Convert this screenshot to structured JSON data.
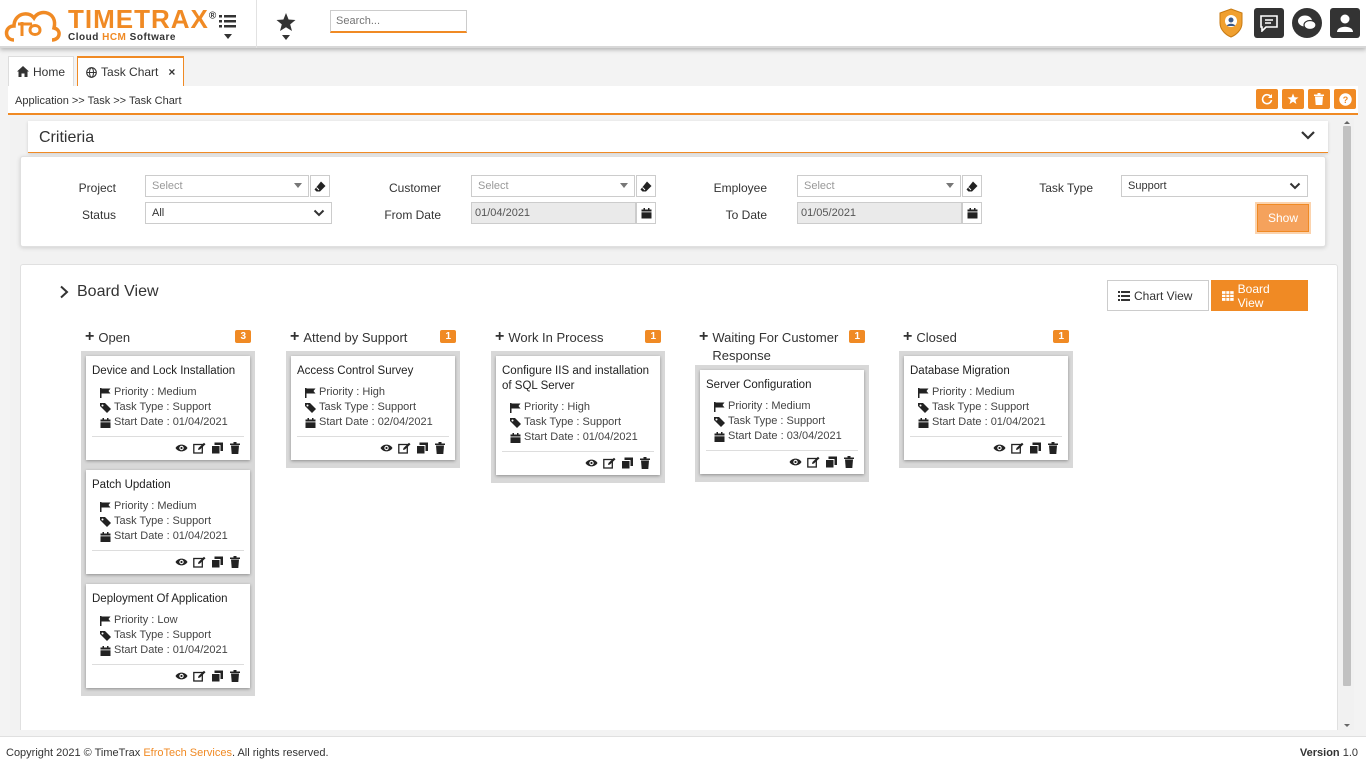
{
  "app": {
    "logo_title": "TIMETRAX",
    "logo_registered": "®",
    "logo_sub_prefix": "Cloud ",
    "logo_sub_accent": "HCM",
    "logo_sub_suffix": " Software",
    "search_placeholder": "Search...",
    "accent_color": "#f08a24"
  },
  "tabs": [
    {
      "label": "Home",
      "icon": "home-icon",
      "active": false
    },
    {
      "label": "Task Chart",
      "icon": "globe-icon",
      "active": true,
      "closable": true
    }
  ],
  "breadcrumb": "Application >> Task >> Task Chart",
  "criteria": {
    "title": "Critieria",
    "fields": {
      "project": {
        "label": "Project",
        "value": "Select"
      },
      "customer": {
        "label": "Customer",
        "value": "Select"
      },
      "employee": {
        "label": "Employee",
        "value": "Select"
      },
      "task_type": {
        "label": "Task Type",
        "value": "Support"
      },
      "status": {
        "label": "Status",
        "value": "All"
      },
      "from_date": {
        "label": "From Date",
        "value": "01/04/2021"
      },
      "to_date": {
        "label": "To Date",
        "value": "01/05/2021"
      }
    },
    "show_label": "Show"
  },
  "board": {
    "title": "Board View",
    "chart_view_label": "Chart View",
    "board_view_label": "Board View",
    "columns": [
      {
        "name": "Open",
        "count": "3",
        "cards": [
          {
            "title": "Device and Lock Installation",
            "priority": "Priority : Medium",
            "type": "Task Type : Support",
            "start": "Start Date : 01/04/2021"
          },
          {
            "title": "Patch Updation",
            "priority": "Priority : Medium",
            "type": "Task Type : Support",
            "start": "Start Date : 01/04/2021"
          },
          {
            "title": "Deployment Of Application",
            "priority": "Priority : Low",
            "type": "Task Type : Support",
            "start": "Start Date : 01/04/2021"
          }
        ]
      },
      {
        "name": "Attend by Support",
        "count": "1",
        "cards": [
          {
            "title": "Access Control Survey",
            "priority": "Priority : High",
            "type": "Task Type : Support",
            "start": "Start Date : 02/04/2021"
          }
        ]
      },
      {
        "name": "Work In Process",
        "count": "1",
        "cards": [
          {
            "title": "Configure IIS and installation of SQL Server",
            "priority": "Priority : High",
            "type": "Task Type : Support",
            "start": "Start Date : 01/04/2021"
          }
        ]
      },
      {
        "name": "Waiting For Customer Response",
        "count": "1",
        "cards": [
          {
            "title": "Server Configuration",
            "priority": "Priority : Medium",
            "type": "Task Type : Support",
            "start": "Start Date : 03/04/2021"
          }
        ]
      },
      {
        "name": "Closed",
        "count": "1",
        "cards": [
          {
            "title": "Database Migration",
            "priority": "Priority : Medium",
            "type": "Task Type : Support",
            "start": "Start Date : 01/04/2021"
          }
        ]
      }
    ]
  },
  "footer": {
    "copyright_prefix": "Copyright 2021 © TimeTrax ",
    "org": "EfroTech Services",
    "copyright_suffix": ". All rights reserved.",
    "version_label": "Version",
    "version": "1.0"
  }
}
